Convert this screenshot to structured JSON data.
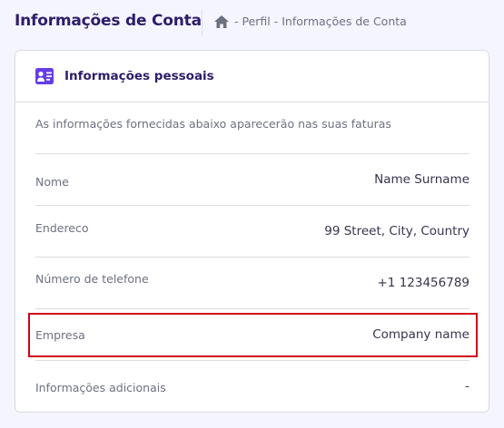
{
  "header": {
    "title": "Informações de Conta",
    "breadcrumb": {
      "home_icon": "home-icon",
      "items": [
        "- Perfil",
        "- Informações de Conta"
      ]
    }
  },
  "card": {
    "icon": "id-card-icon",
    "title": "Informações pessoais",
    "description": "As informações fornecidas abaixo aparecerão nas suas faturas",
    "rows": [
      {
        "label": "Nome",
        "value": "Name Surname"
      },
      {
        "label": "Endereco",
        "value": "99 Street, City, Country"
      },
      {
        "label": "Número de telefone",
        "value": "+1 123456789"
      },
      {
        "label": "Empresa",
        "value": "Company name"
      },
      {
        "label": "Informações adicionais",
        "value": "-"
      }
    ]
  },
  "colors": {
    "background": "#f4f5ff",
    "primary_text": "#2f1c6a",
    "secondary_text": "#6d7081",
    "accent_purple": "#673de6",
    "highlight": "#d0021b"
  }
}
